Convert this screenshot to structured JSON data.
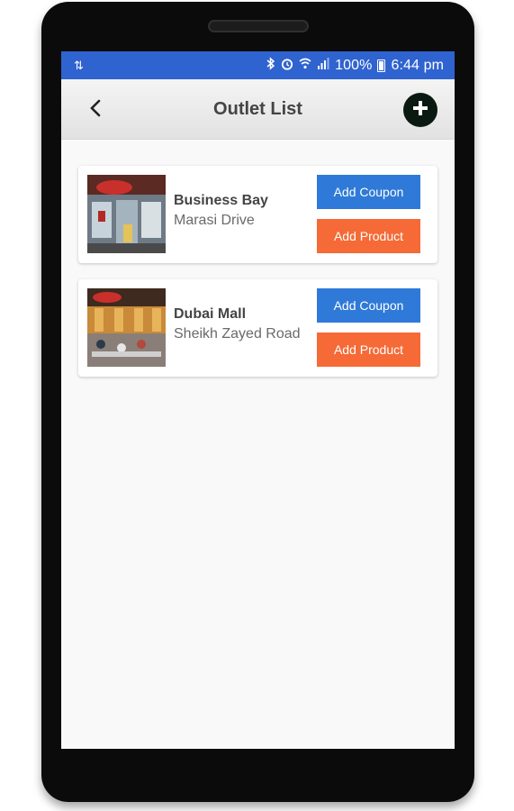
{
  "status_bar": {
    "battery": "100%",
    "time": "6:44 pm"
  },
  "header": {
    "title": "Outlet List"
  },
  "outlets": [
    {
      "name": "Business Bay",
      "address": "Marasi Drive",
      "coupon_label": "Add Coupon",
      "product_label": "Add Product"
    },
    {
      "name": "Dubai Mall",
      "address": "Sheikh Zayed Road",
      "coupon_label": "Add Coupon",
      "product_label": "Add Product"
    }
  ],
  "colors": {
    "status_bar": "#2f63cf",
    "coupon_button": "#2f7ad8",
    "product_button": "#f56a36",
    "add_button": "#0a1a10"
  },
  "icons": {
    "back": "chevron-left-icon",
    "add": "plus-icon",
    "bluetooth": "bluetooth-icon",
    "alarm": "alarm-icon",
    "wifi": "wifi-icon",
    "signal": "signal-icon",
    "battery": "battery-icon",
    "data": "data-transfer-icon"
  }
}
